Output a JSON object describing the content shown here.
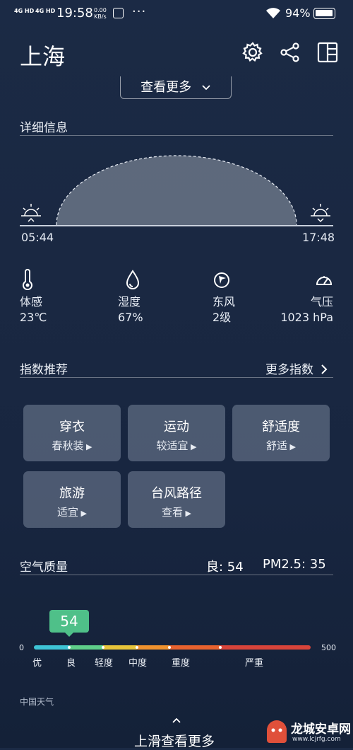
{
  "status_bar": {
    "sim1": "4G HD",
    "sim2": "4G HD",
    "time": "19:58",
    "speed_value": "0.00",
    "speed_unit": "KB/s",
    "more_dots": "···",
    "battery": "94%"
  },
  "header": {
    "city": "上海",
    "icons": [
      "gear-icon",
      "share-icon",
      "widget-icon"
    ]
  },
  "more_button": {
    "label": "查看更多",
    "icon": "chevron-down-icon"
  },
  "details": {
    "title": "详细信息",
    "sunrise": "05:44",
    "sunset": "17:48",
    "items": [
      {
        "icon": "thermometer-icon",
        "label": "体感",
        "value": "23℃"
      },
      {
        "icon": "droplet-icon",
        "label": "湿度",
        "value": "67%"
      },
      {
        "icon": "wind-direction-icon",
        "label": "东风",
        "value": "2级"
      },
      {
        "icon": "pressure-gauge-icon",
        "label": "气压",
        "value": "1023 hPa"
      }
    ]
  },
  "indices": {
    "title": "指数推荐",
    "more": "更多指数",
    "tiles": [
      {
        "title": "穿衣",
        "sub": "春秋装"
      },
      {
        "title": "运动",
        "sub": "较适宜"
      },
      {
        "title": "舒适度",
        "sub": "舒适"
      },
      {
        "title": "旅游",
        "sub": "适宜"
      },
      {
        "title": "台风路径",
        "sub": "查看"
      }
    ]
  },
  "air_quality": {
    "title": "空气质量",
    "aqi_text": "良: 54",
    "pm25_text": "PM2.5: 35",
    "aqi_value": "54",
    "scale_min": "0",
    "scale_max": "500",
    "levels": [
      "优",
      "良",
      "轻度",
      "中度",
      "重度",
      "严重"
    ],
    "colors": [
      "#3ec4d6",
      "#5fcf8a",
      "#e7c43a",
      "#f0922e",
      "#e8622e",
      "#d8443a"
    ]
  },
  "footer": {
    "source": "中国天气",
    "swipe_hint": "上滑查看更多",
    "watermark": "龙城安卓网",
    "watermark_url": "www.lcjrfg.com"
  }
}
